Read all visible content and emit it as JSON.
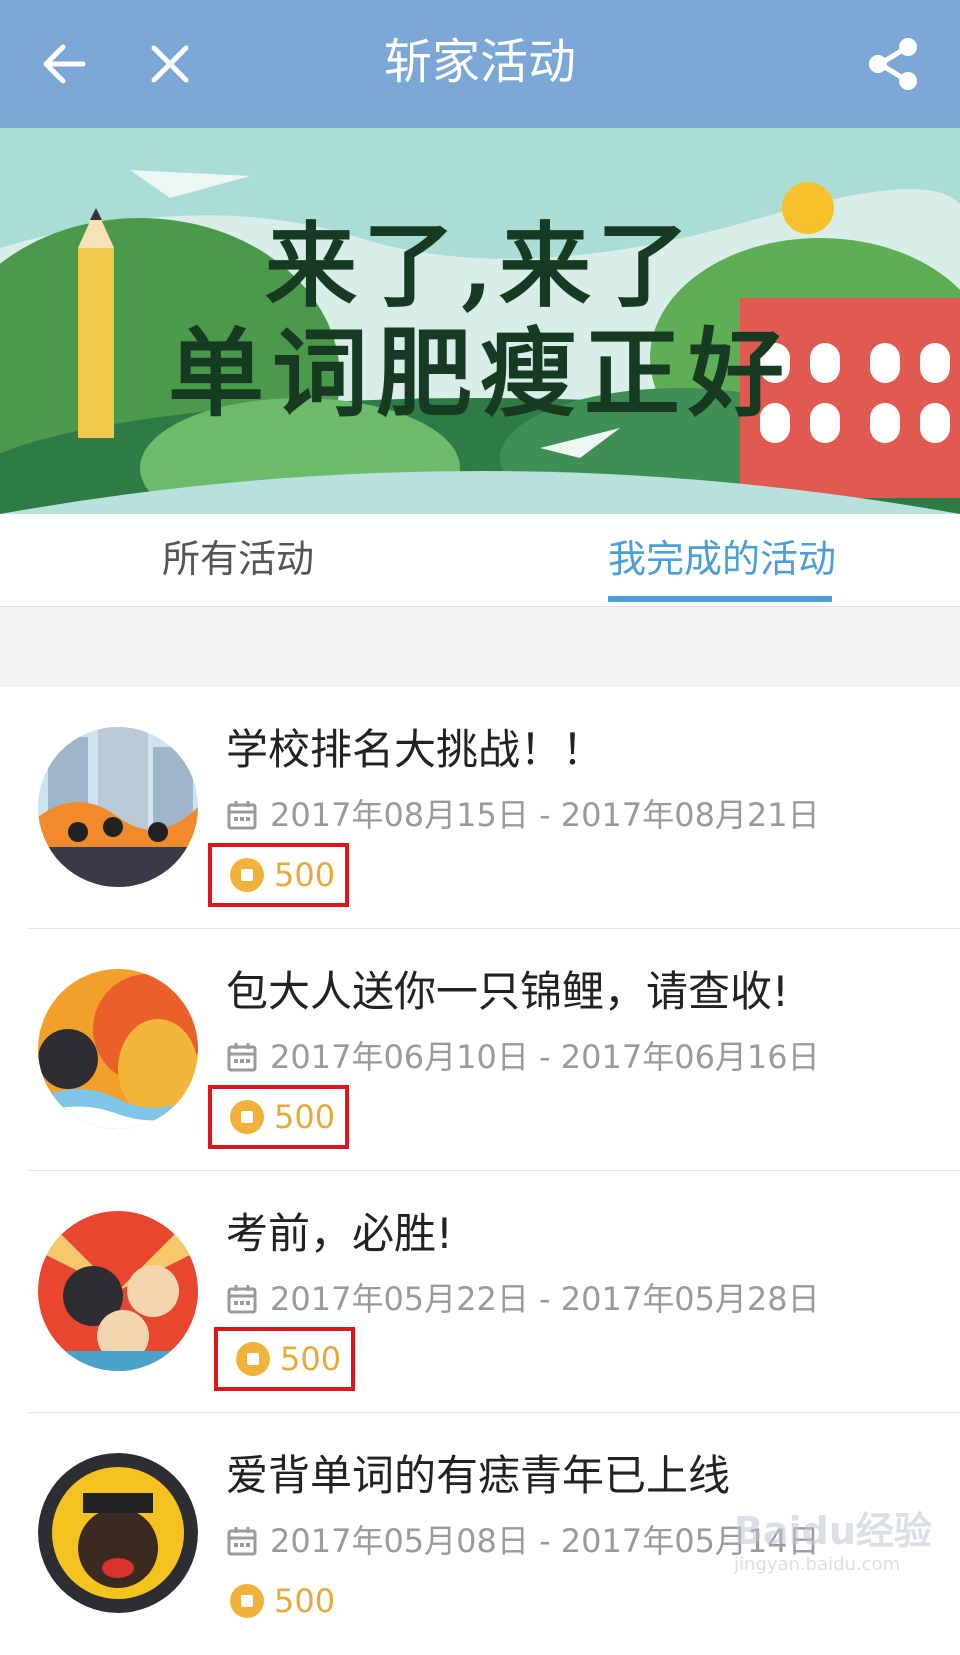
{
  "header": {
    "title": "斩家活动",
    "back_icon": "arrow-left-icon",
    "close_icon": "close-icon",
    "share_icon": "share-icon"
  },
  "banner": {
    "line1": "来了,来了",
    "line2": "单词肥瘦正好"
  },
  "tabs": [
    {
      "label": "所有活动",
      "active": false
    },
    {
      "label": "我完成的活动",
      "active": true
    }
  ],
  "activities": [
    {
      "title": "学校排名大挑战！！",
      "date": "2017年08月15日 - 2017年08月21日",
      "coins": "500"
    },
    {
      "title": "包大人送你一只锦鲤，请查收!",
      "date": "2017年06月10日 - 2017年06月16日",
      "coins": "500"
    },
    {
      "title": "考前，必胜!",
      "date": "2017年05月22日 - 2017年05月28日",
      "coins": "500"
    },
    {
      "title": "爱背单词的有痣青年已上线",
      "date": "2017年05月08日 - 2017年05月14日",
      "coins": "500"
    }
  ],
  "watermark": {
    "brand": "Baidu经验",
    "url": "jingyan.baidu.com"
  },
  "colors": {
    "header_bg": "#7ba7d6",
    "tab_active": "#4a9fd7",
    "coin": "#f0b23a",
    "highlight_box": "#e0141e"
  }
}
